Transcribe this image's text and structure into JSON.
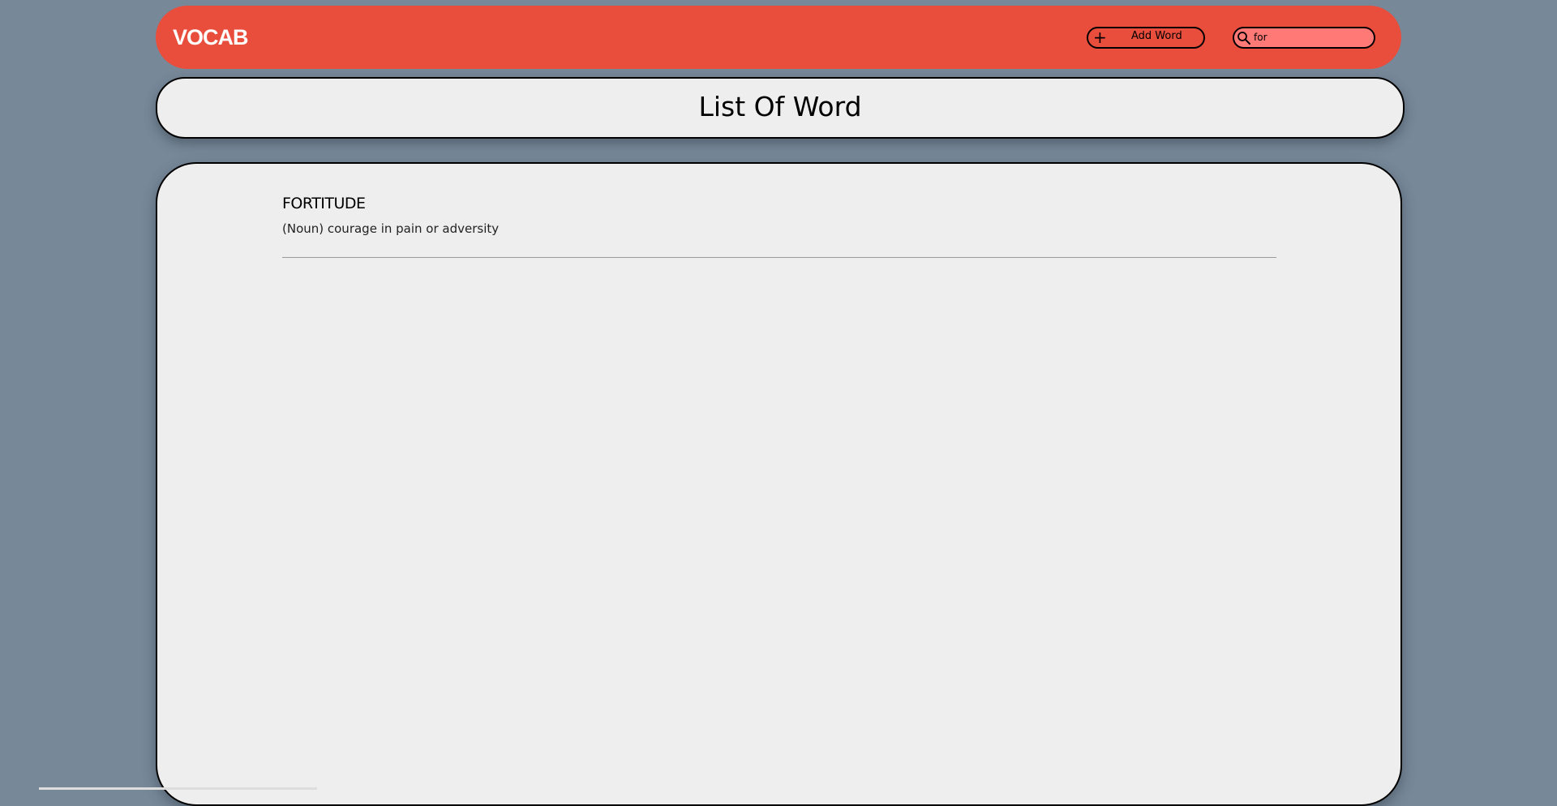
{
  "navbar": {
    "brand": "VOCAB",
    "add_button_label": "Add Word",
    "add_icon": "plus-icon",
    "search_icon": "search-icon",
    "search_value": "for"
  },
  "page": {
    "title": "List Of Word"
  },
  "words": [
    {
      "word": "FORTITUDE",
      "definition": "(Noun) courage in pain or adversity"
    }
  ],
  "colors": {
    "background": "#778899",
    "navbar": "#E94E3D",
    "search_field": "#FF7A77",
    "card": "#EEEEEE"
  }
}
